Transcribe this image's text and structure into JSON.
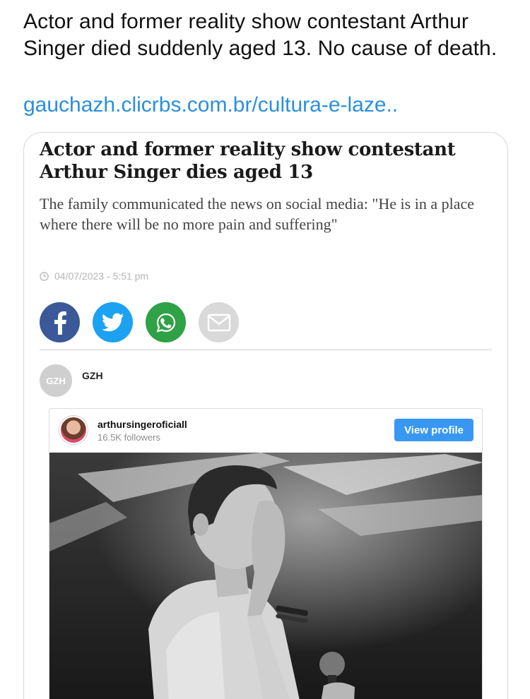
{
  "post": {
    "text": "Actor and former reality show contestant Arthur Singer died suddenly aged 13. No cause of death.",
    "link": "gauchazh.clicrbs.com.br/cultura-e-laze.."
  },
  "card": {
    "title": "Actor and former reality show contestant Arthur Singer dies aged 13",
    "subtitle": "The family communicated the news on social media: \"He is in a place where there will be no more pain and suffering\"",
    "date": "04/07/2023 - 5:51 pm",
    "share": {
      "facebook": "facebook-icon",
      "twitter": "twitter-icon",
      "whatsapp": "whatsapp-icon",
      "email": "mail-icon"
    },
    "source": {
      "logo_text": "GZH",
      "name": "GZH"
    }
  },
  "instagram": {
    "username": "arthursingeroficiall",
    "followers": "16.5K followers",
    "view_profile_label": "View profile"
  },
  "colors": {
    "link": "#2a8fde",
    "facebook": "#3b5998",
    "twitter": "#1da1f2",
    "whatsapp": "#2fa146",
    "email": "#d9d9d9",
    "instagram_button": "#3897f0"
  }
}
